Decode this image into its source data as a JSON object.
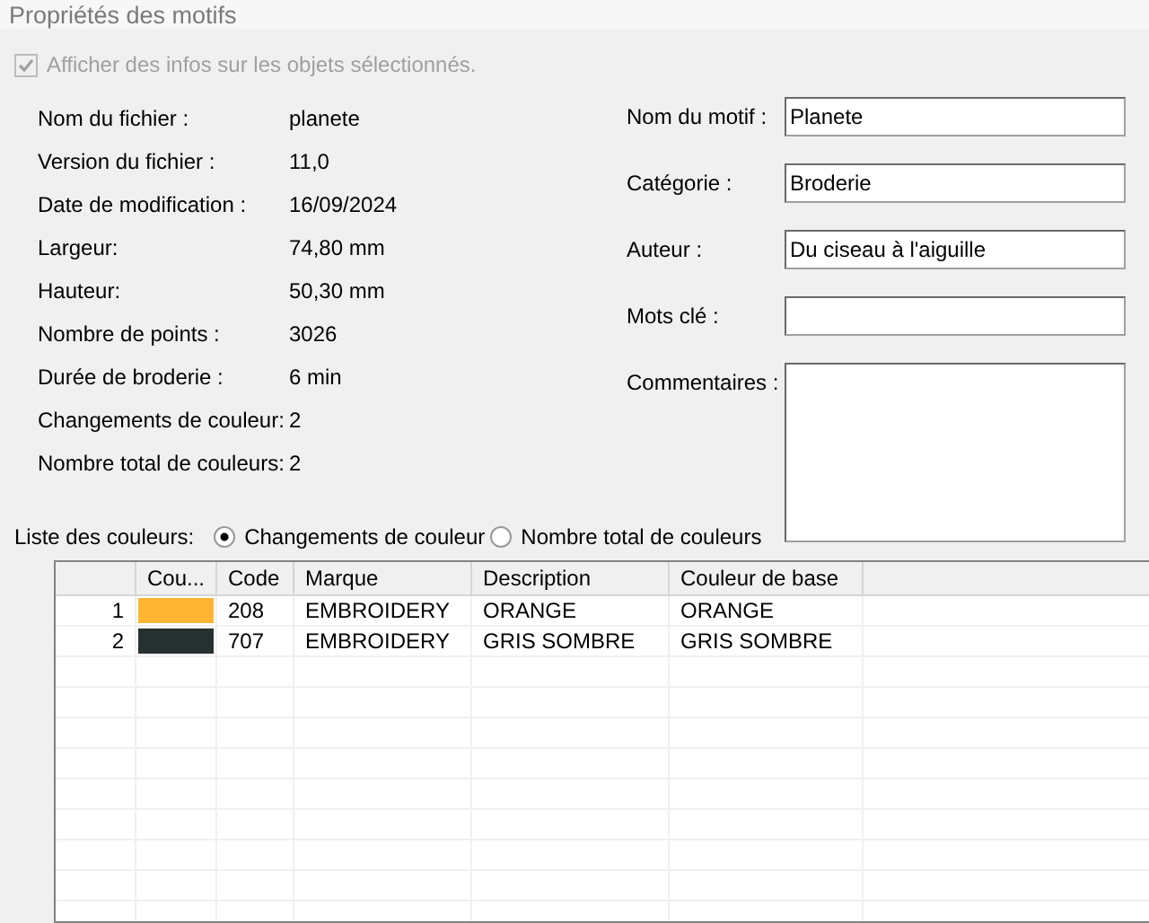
{
  "title": "Propriétés des motifs",
  "show_info": {
    "label": "Afficher des infos sur les objets sélectionnés.",
    "checked": true,
    "disabled": true
  },
  "info": [
    {
      "label": "Nom du fichier :",
      "value": "planete"
    },
    {
      "label": "Version du fichier :",
      "value": "11,0"
    },
    {
      "label": "Date de modification :",
      "value": "16/09/2024"
    },
    {
      "label": "Largeur:",
      "value": "74,80 mm"
    },
    {
      "label": "Hauteur:",
      "value": "50,30 mm"
    },
    {
      "label": "Nombre de points :",
      "value": "3026"
    },
    {
      "label": "Durée de broderie :",
      "value": "6 min"
    },
    {
      "label": "Changements de couleur:",
      "value": "2"
    },
    {
      "label": "Nombre total de couleurs:",
      "value": "2"
    }
  ],
  "fields": [
    {
      "label": "Nom du motif :",
      "value": "Planete",
      "kind": "text"
    },
    {
      "label": "Catégorie :",
      "value": "Broderie",
      "kind": "text"
    },
    {
      "label": "Auteur :",
      "value": "Du ciseau à l'aiguille",
      "kind": "text"
    },
    {
      "label": "Mots clé :",
      "kind": "text"
    },
    {
      "label": "Commentaires :",
      "kind": "textarea"
    }
  ],
  "color_list": {
    "label": "Liste des couleurs:",
    "options": [
      {
        "label": "Changements de couleur",
        "selected": true
      },
      {
        "label": "Nombre total de couleurs",
        "selected": false
      }
    ]
  },
  "table": {
    "columns": [
      "Cou...",
      "Code",
      "Marque",
      "Description",
      "Couleur de base"
    ],
    "rows": [
      {
        "index": "1",
        "color": "#ffb533",
        "code": "208",
        "brand": "EMBROIDERY",
        "description": "ORANGE",
        "base_color": "ORANGE"
      },
      {
        "index": "2",
        "color": "#273030",
        "code": "707",
        "brand": "EMBROIDERY",
        "description": "GRIS SOMBRE",
        "base_color": "GRIS SOMBRE"
      }
    ]
  }
}
